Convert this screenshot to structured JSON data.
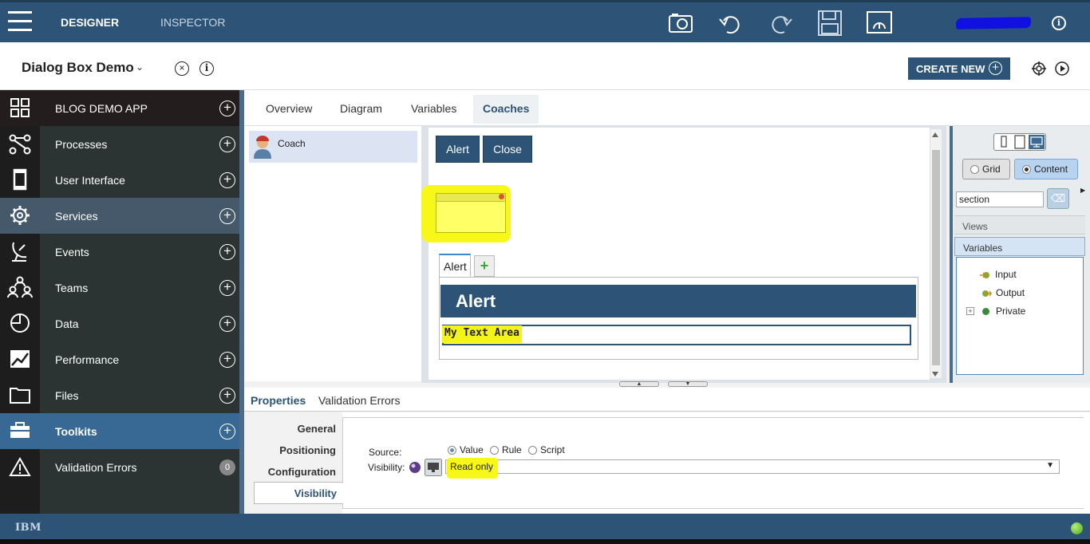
{
  "topbar": {
    "tabs": [
      "DESIGNER",
      "INSPECTOR"
    ],
    "icons": [
      "camera-icon",
      "undo-icon",
      "redo-icon",
      "save-icon",
      "dashboard-icon",
      "info-icon"
    ],
    "info_glyph": "i"
  },
  "header": {
    "title": "Dialog Box Demo",
    "chevron": "⌄",
    "close_glyph": "×",
    "info_glyph": "i",
    "create_new_label": "CREATE NEW",
    "plus_glyph": "+"
  },
  "sidebar": {
    "items": [
      {
        "label": "BLOG DEMO APP",
        "icon": "grid-icon",
        "action": "+"
      },
      {
        "label": "Processes",
        "icon": "processes-icon",
        "action": "+"
      },
      {
        "label": "User Interface",
        "icon": "phone-icon",
        "action": "+"
      },
      {
        "label": "Services",
        "icon": "gear-icon",
        "action": "+"
      },
      {
        "label": "Events",
        "icon": "satellite-icon",
        "action": "+"
      },
      {
        "label": "Teams",
        "icon": "teams-icon",
        "action": "+"
      },
      {
        "label": "Data",
        "icon": "data-icon",
        "action": "+"
      },
      {
        "label": "Performance",
        "icon": "chart-icon",
        "action": "+"
      },
      {
        "label": "Files",
        "icon": "folder-icon",
        "action": "+"
      },
      {
        "label": "Toolkits",
        "icon": "toolbox-icon",
        "action": "+"
      },
      {
        "label": "Validation Errors",
        "icon": "warning-icon",
        "count": "0"
      }
    ]
  },
  "main_tabs": [
    "Overview",
    "Diagram",
    "Variables",
    "Coaches"
  ],
  "coach_list": {
    "items": [
      "Coach"
    ]
  },
  "canvas": {
    "buttons": [
      "Alert",
      "Close"
    ],
    "tab_label": "Alert",
    "tab_add": "+",
    "alert_header": "Alert",
    "text_area_label": "My Text Area"
  },
  "palette": {
    "modes": [
      "Grid",
      "Content"
    ],
    "selected_mode": "Content",
    "search_value": "section",
    "sections": [
      "Views",
      "Variables"
    ],
    "variables": [
      "Input",
      "Output",
      "Private"
    ],
    "expand_glyph": "+",
    "menu_glyph": "▶",
    "clear_glyph": "⌫"
  },
  "properties": {
    "tabs": [
      "Properties",
      "Validation Errors"
    ],
    "nav": [
      "General",
      "Positioning",
      "Configuration",
      "Visibility"
    ],
    "source_label": "Source:",
    "source_options": [
      "Value",
      "Rule",
      "Script"
    ],
    "source_selected": "Value",
    "visibility_label": "Visibility:",
    "visibility_value": "Read only",
    "dropdown_glyph": "▼"
  },
  "footer": {
    "brand": "IBM"
  },
  "colors": {
    "primary": "#2d5476",
    "sidebar": "#2b3432",
    "highlight": "#f7f71a"
  }
}
